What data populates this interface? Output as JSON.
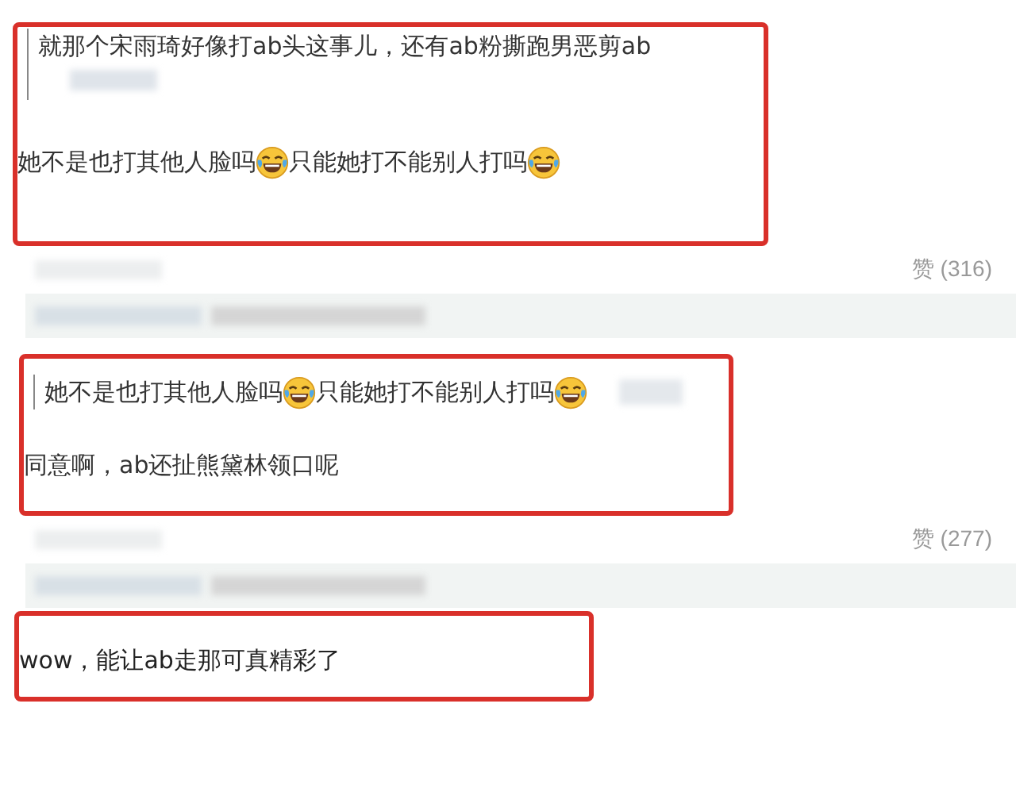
{
  "blocks": [
    {
      "kind": "reply",
      "quote": {
        "kind": "stacked",
        "segments": [
          {
            "kind": "text",
            "text": "就那个宋雨琦好像打ab头这事儿，还有ab粉撕跑男恶剪ab"
          }
        ]
      },
      "body": [
        {
          "kind": "text",
          "text": "她不是也打其他人脸吗"
        },
        {
          "kind": "emoji"
        },
        {
          "kind": "text",
          "text": "只能她打不能别人打吗"
        },
        {
          "kind": "emoji"
        }
      ]
    },
    {
      "kind": "meta",
      "likes": "赞 (316)"
    },
    {
      "kind": "reply",
      "quote": {
        "kind": "inline",
        "segments": [
          {
            "kind": "text",
            "text": "她不是也打其他人脸吗"
          },
          {
            "kind": "emoji"
          },
          {
            "kind": "text",
            "text": "只能她打不能别人打吗"
          },
          {
            "kind": "emoji"
          }
        ]
      },
      "body": [
        {
          "kind": "text",
          "text": "同意啊，ab还扯熊黛林领口呢"
        }
      ]
    },
    {
      "kind": "meta",
      "likes": "赞 (277)"
    },
    {
      "kind": "reply",
      "body": [
        {
          "kind": "text",
          "text": "wow，能让ab走那可真精彩了"
        }
      ]
    }
  ]
}
